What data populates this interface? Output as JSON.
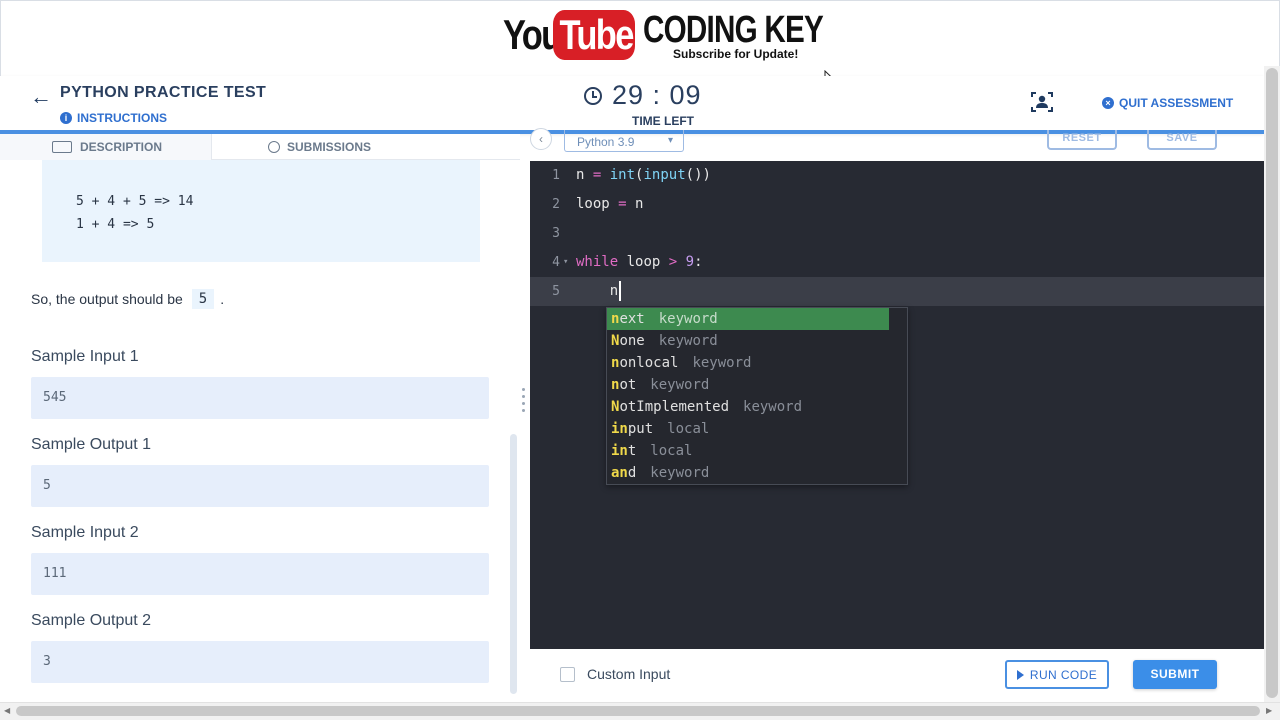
{
  "banner": {
    "logo_you": "You",
    "logo_tube": "Tube",
    "logo_channel": "CODING KEY",
    "logo_tagline": "Subscribe for Update!"
  },
  "header": {
    "title": "PYTHON PRACTICE TEST",
    "instructions_label": "INSTRUCTIONS",
    "timer_value": "29 : 09",
    "timer_label": "TIME LEFT",
    "quit_label": "QUIT ASSESSMENT"
  },
  "left": {
    "tabs": [
      {
        "label": "DESCRIPTION",
        "icon": "document-icon"
      },
      {
        "label": "SUBMISSIONS",
        "icon": "history-icon"
      }
    ],
    "example_lines": [
      "5 + 4 + 5 => 14",
      "1 + 4 => 5"
    ],
    "output_prefix": "So, the output should be",
    "output_value": "5",
    "output_suffix": ".",
    "samples": [
      {
        "label": "Sample Input 1",
        "value": "545"
      },
      {
        "label": "Sample Output 1",
        "value": "5"
      },
      {
        "label": "Sample Input 2",
        "value": "111"
      },
      {
        "label": "Sample Output 2",
        "value": "3"
      }
    ]
  },
  "editor": {
    "language": "Python 3.9",
    "reset_label": "RESET",
    "save_label": "SAVE",
    "lines": [
      {
        "num": "1"
      },
      {
        "num": "2"
      },
      {
        "num": "3"
      },
      {
        "num": "4"
      },
      {
        "num": "5"
      }
    ],
    "code": {
      "l1_var": "n",
      "l1_eq": "=",
      "l1_int": "int",
      "l1_input": "input",
      "l1_tail": "())",
      "l2_var": "loop",
      "l2_eq": "=",
      "l2_val": "n",
      "l4_kw": "while",
      "l4_var": "loop",
      "l4_op": ">",
      "l4_num": "9",
      "l4_colon": ":",
      "l5_typed": "n"
    },
    "suggestions": [
      {
        "match": "n",
        "rest": "ext",
        "kind": "keyword"
      },
      {
        "match": "N",
        "rest": "one",
        "kind": "keyword"
      },
      {
        "match": "n",
        "rest": "onlocal",
        "kind": "keyword"
      },
      {
        "match": "n",
        "rest": "ot",
        "kind": "keyword"
      },
      {
        "match": "N",
        "rest": "otImplemented",
        "kind": "keyword"
      },
      {
        "match": "in",
        "rest": "put",
        "kind": "local",
        "split": true
      },
      {
        "match": "in",
        "rest": "t",
        "kind": "local",
        "split": true
      },
      {
        "match": "an",
        "rest": "d",
        "kind": "keyword",
        "split": true
      }
    ]
  },
  "bottom": {
    "custom_input_label": "Custom Input",
    "run_label": "RUN CODE",
    "submit_label": "SUBMIT"
  },
  "colors": {
    "accent": "#3b8ee8",
    "editor_bg": "#272a33",
    "suggest_selected": "#3d8a4f",
    "logo_red": "#d81f26"
  }
}
